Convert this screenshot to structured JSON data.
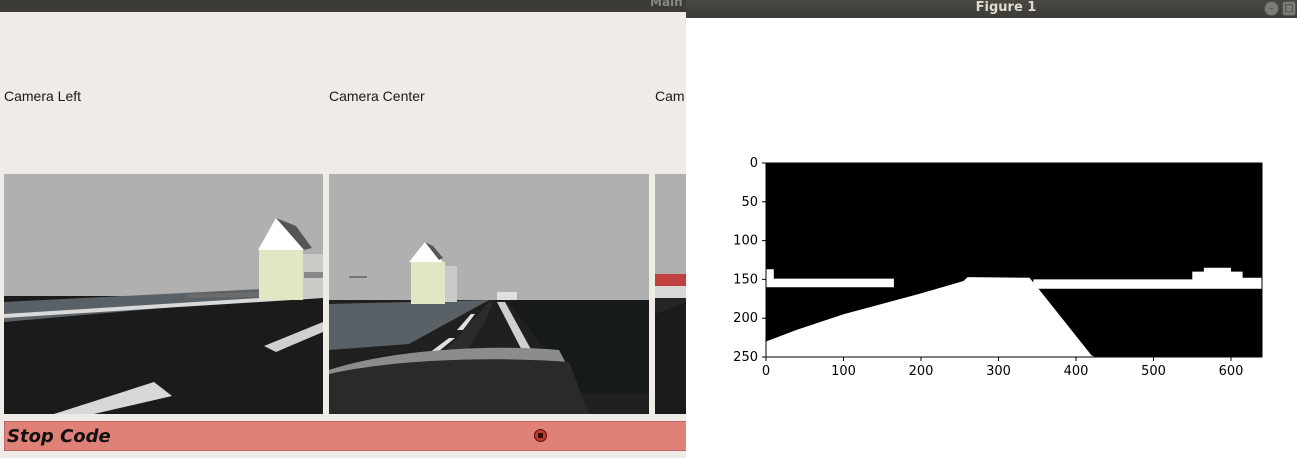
{
  "main_window": {
    "title": "Main",
    "cameras": [
      {
        "label": "Camera Left"
      },
      {
        "label": "Camera Center"
      },
      {
        "label": "Cam"
      }
    ],
    "stop_button": {
      "label": "Stop Code",
      "icon": "stop-icon",
      "color": "#e08178"
    }
  },
  "figure_window": {
    "title": "Figure 1",
    "controls": {
      "minimize": "–",
      "maximize": "□"
    },
    "chart_data": {
      "type": "heatmap",
      "title": "",
      "xlabel": "",
      "ylabel": "",
      "xlim": [
        0,
        640
      ],
      "ylim": [
        250,
        0
      ],
      "colormap": "binary (black / white)",
      "x_ticks": [
        "0",
        "100",
        "200",
        "300",
        "400",
        "500",
        "600"
      ],
      "y_ticks": [
        "0",
        "50",
        "100",
        "150",
        "200",
        "250"
      ],
      "white_regions": [
        {
          "name": "road",
          "polygon": [
            [
              0,
              230
            ],
            [
              0,
              253
            ],
            [
              425,
              253
            ],
            [
              420,
              248
            ],
            [
              350,
              160
            ],
            [
              340,
              148
            ],
            [
              260,
              147
            ],
            [
              255,
              152
            ],
            [
              200,
              168
            ],
            [
              100,
              195
            ],
            [
              40,
              215
            ]
          ]
        },
        {
          "name": "horizon-strip",
          "polygon": [
            [
              0,
              137
            ],
            [
              10,
              137
            ],
            [
              10,
              149
            ],
            [
              165,
              149
            ],
            [
              165,
              160
            ],
            [
              0,
              160
            ]
          ]
        },
        {
          "name": "horizon-strip-right",
          "polygon": [
            [
              345,
              150
            ],
            [
              550,
              150
            ],
            [
              550,
              140
            ],
            [
              565,
              140
            ],
            [
              565,
              135
            ],
            [
              600,
              135
            ],
            [
              600,
              140
            ],
            [
              615,
              140
            ],
            [
              615,
              148
            ],
            [
              640,
              148
            ],
            [
              640,
              162
            ],
            [
              345,
              162
            ]
          ]
        }
      ]
    }
  }
}
